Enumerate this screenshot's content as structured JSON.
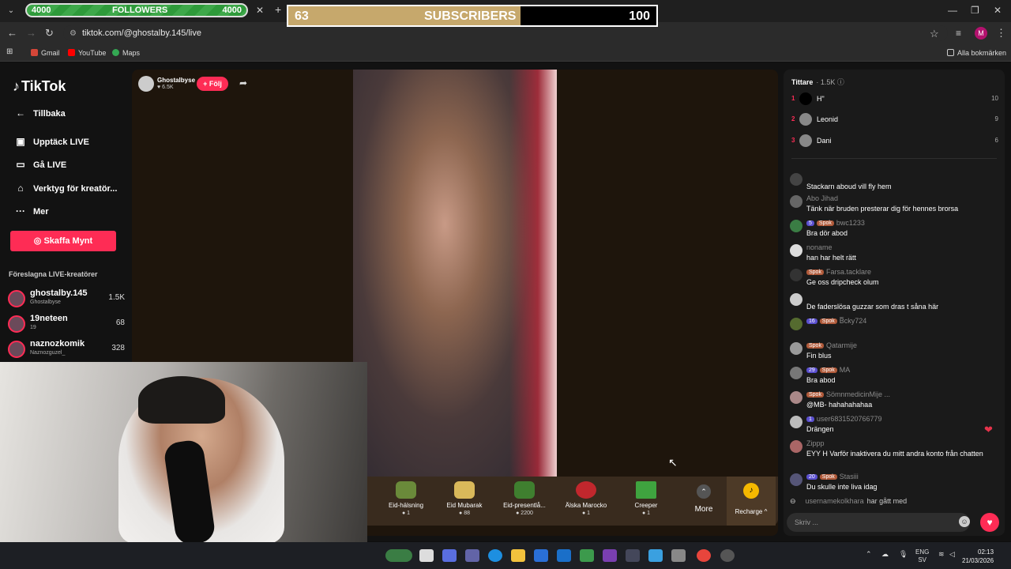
{
  "overlays": {
    "followers": {
      "left": "4000",
      "label": "FOLLOWERS",
      "right": "4000"
    },
    "subscribers": {
      "left": "63",
      "label": "SUBSCRIBERS",
      "right": "100",
      "progress": 0.63
    }
  },
  "browser": {
    "url": "tiktok.com/@ghostalby.145/live",
    "bookmarks": [
      "Gmail",
      "YouTube",
      "Maps"
    ],
    "all_bookmarks": "Alla bokmärken",
    "profile_initial": "M"
  },
  "sidebar": {
    "logo": "TikTok",
    "back": "Tillbaka",
    "nav": [
      "Upptäck LIVE",
      "Gå LIVE",
      "Verktyg för kreatör...",
      "Mer"
    ],
    "coins_button": "Skaffa Mynt",
    "suggested_title": "Föreslagna LIVE-kreatörer",
    "creators": [
      {
        "name": "ghostalby.145",
        "sub": "Ghostalbyse",
        "count": "1.5K"
      },
      {
        "name": "19neteen",
        "sub": "19",
        "count": "68"
      },
      {
        "name": "naznozkomik",
        "sub": "Naznozguzel_",
        "count": "328"
      }
    ]
  },
  "stream": {
    "host_name": "Ghostalbyse",
    "host_likes": "6.5K",
    "follow": "+ Följ",
    "gifts": [
      {
        "name": "Eid-hälsning",
        "price": "1"
      },
      {
        "name": "Eid Mubarak",
        "price": "88"
      },
      {
        "name": "Eid-presentlå...",
        "price": "2200"
      },
      {
        "name": "Älska Marocko",
        "price": "1"
      },
      {
        "name": "Creeper",
        "price": "1"
      }
    ],
    "more": "More",
    "recharge": "Recharge ^"
  },
  "chat": {
    "viewers_title": "Tittare",
    "viewers_count": "1.5K",
    "top_viewers": [
      {
        "rank": "1",
        "name": "H\"",
        "score": "10"
      },
      {
        "rank": "2",
        "name": "Leonid",
        "score": "9"
      },
      {
        "rank": "3",
        "name": "Dani",
        "score": "6"
      }
    ],
    "messages": [
      {
        "user": "",
        "badges": [],
        "text": "Stackarn aboud vill fly hem"
      },
      {
        "user": "Abo Jihad",
        "badges": [],
        "text": "Tänk när bruden presterar dig för hennes brorsa"
      },
      {
        "user": "bwc1233",
        "badges": [
          "5",
          "Spok"
        ],
        "text": "Bra dör abod"
      },
      {
        "user": "noname",
        "badges": [],
        "text": "han har helt rätt"
      },
      {
        "user": "Farsa.tacklare",
        "badges": [
          "Spok"
        ],
        "text": "Ge oss dripcheck olum"
      },
      {
        "user": "",
        "badges": [],
        "text": "De faderslösa guzzar som dras t såna här"
      },
      {
        "user": "B̅cky724",
        "badges": [
          "16",
          "Spok"
        ],
        "text": ""
      },
      {
        "user": "Qatarmije",
        "badges": [
          "Spok"
        ],
        "text": "Fin blus"
      },
      {
        "user": "MA",
        "badges": [
          "29",
          "Spok"
        ],
        "text": "Bra abod"
      },
      {
        "user": "SömnmedicinMije ...",
        "badges": [
          "Spok"
        ],
        "text": "@MB- hahahahahaa"
      },
      {
        "user": "user6831520766779",
        "badges": [
          "1"
        ],
        "text": "Drängen"
      },
      {
        "user": "Zippp",
        "badges": [],
        "text": "EYY H Varför inaktivera du mitt andra konto från chatten"
      },
      {
        "user": "Stasiii",
        "badges": [
          "20",
          "Spok"
        ],
        "text": "Du skulle inte liva idag"
      }
    ],
    "join_user": "usernamekolkhara",
    "join_text": "har gått med",
    "input_placeholder": "Skriv ..."
  },
  "taskbar": {
    "lang": "ENG",
    "region": "SV",
    "time": "02:13",
    "date": "21/03/2026"
  }
}
